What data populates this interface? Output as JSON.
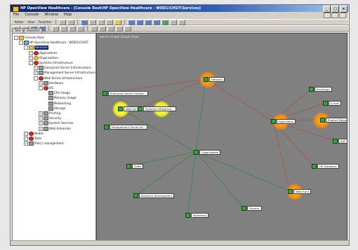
{
  "window": {
    "title": "HP OpenView Healthcare - [Console Root\\HP OpenView Healthcare - WOD1\\CHSIT\\Services]"
  },
  "menu": [
    "File",
    "Console",
    "Window",
    "Help"
  ],
  "toolbar1": {
    "items": [
      "Action",
      "View",
      "Favorites"
    ]
  },
  "panel_tabs": [
    "Tree",
    "Favorites"
  ],
  "tree": [
    {
      "label": "Console Root",
      "icon": "folder-icon",
      "kind": "folder",
      "level": 0,
      "exp": "-"
    },
    {
      "label": "HP OpenView Healthcare - WOD1\\CHSIT",
      "icon": "server-icon",
      "kind": "server",
      "level": 1,
      "exp": "-"
    },
    {
      "label": "Services",
      "icon": "folder-icon",
      "kind": "folder",
      "level": 2,
      "exp": "-",
      "selected": true
    },
    {
      "label": "Applications",
      "icon": "red-status-icon",
      "kind": "red",
      "level": 3,
      "exp": "+"
    },
    {
      "label": "Organization",
      "icon": "yellow-status-icon",
      "kind": "yellow",
      "level": 3,
      "exp": "+"
    },
    {
      "label": "Systems Infrastructure",
      "icon": "red-status-icon",
      "kind": "red",
      "level": 3,
      "exp": "-"
    },
    {
      "label": "Enterprise Server Infrastructure",
      "icon": "grey-status-icon",
      "kind": "grey",
      "level": 4,
      "exp": "+"
    },
    {
      "label": "Management Server Infrastructure",
      "icon": "grey-status-icon",
      "kind": "grey",
      "level": 4,
      "exp": "+"
    },
    {
      "label": "Web Server Infrastructure",
      "icon": "red-status-icon",
      "kind": "red",
      "level": 4,
      "exp": "-"
    },
    {
      "label": "Hardware",
      "icon": "grey-status-icon",
      "kind": "grey",
      "level": 5,
      "exp": "+"
    },
    {
      "label": "OS",
      "icon": "red-status-icon",
      "kind": "red",
      "level": 5,
      "exp": "-"
    },
    {
      "label": "CPU Usage",
      "icon": "grey-status-icon",
      "kind": "grey",
      "level": 6,
      "exp": ""
    },
    {
      "label": "Memory Usage",
      "icon": "grey-status-icon",
      "kind": "grey",
      "level": 6,
      "exp": ""
    },
    {
      "label": "Networking",
      "icon": "grey-status-icon",
      "kind": "grey",
      "level": 6,
      "exp": ""
    },
    {
      "label": "Storage",
      "icon": "grey-status-icon",
      "kind": "grey",
      "level": 6,
      "exp": ""
    },
    {
      "label": "Printing",
      "icon": "grey-status-icon",
      "kind": "grey",
      "level": 5,
      "exp": "+"
    },
    {
      "label": "Security",
      "icon": "grey-status-icon",
      "kind": "grey",
      "level": 5,
      "exp": "+"
    },
    {
      "label": "System Services",
      "icon": "grey-status-icon",
      "kind": "grey",
      "level": 5,
      "exp": "+"
    },
    {
      "label": "Web Extension",
      "icon": "grey-status-icon",
      "kind": "grey",
      "level": 5,
      "exp": "+"
    },
    {
      "label": "Nodes",
      "icon": "red-status-icon",
      "kind": "red",
      "level": 2,
      "exp": "+"
    },
    {
      "label": "Tools",
      "icon": "red-status-icon",
      "kind": "red",
      "level": 2,
      "exp": "+"
    },
    {
      "label": "Policy management",
      "icon": "grey-status-icon",
      "kind": "grey",
      "level": 2,
      "exp": "+"
    }
  ],
  "canvas": {
    "title": "Service Graph (Graph View)",
    "nodes": [
      {
        "id": "network",
        "label": "Network"
      },
      {
        "id": "enterprise",
        "label": "Enterprise Server Infrastr..."
      },
      {
        "id": "webserver",
        "label": "Web Server Inf..."
      },
      {
        "id": "sysinfra",
        "label": "Systems Infrastruct..."
      },
      {
        "id": "mgmt",
        "label": "Management Server Inf..."
      },
      {
        "id": "application",
        "label": "Application"
      },
      {
        "id": "exchange",
        "label": "Exchange"
      },
      {
        "id": "email",
        "label": "E-mail"
      },
      {
        "id": "product",
        "label": "Product Database"
      },
      {
        "id": "sap",
        "label": "SAP"
      },
      {
        "id": "hrdb",
        "label": "HR Database"
      },
      {
        "id": "webfront",
        "label": "Web Front"
      },
      {
        "id": "organization",
        "label": "Organization"
      },
      {
        "id": "sales",
        "label": "Sales"
      },
      {
        "id": "research",
        "label": "Research Development"
      },
      {
        "id": "finance",
        "label": "Finance"
      },
      {
        "id": "marketing",
        "label": "Marketing"
      }
    ]
  },
  "colors": {
    "halo_orange": "#f08a10",
    "halo_yellow": "#e8e820",
    "node_green": "#3aa040",
    "edge_red": "#c04020",
    "edge_green": "#2e8a3e"
  }
}
